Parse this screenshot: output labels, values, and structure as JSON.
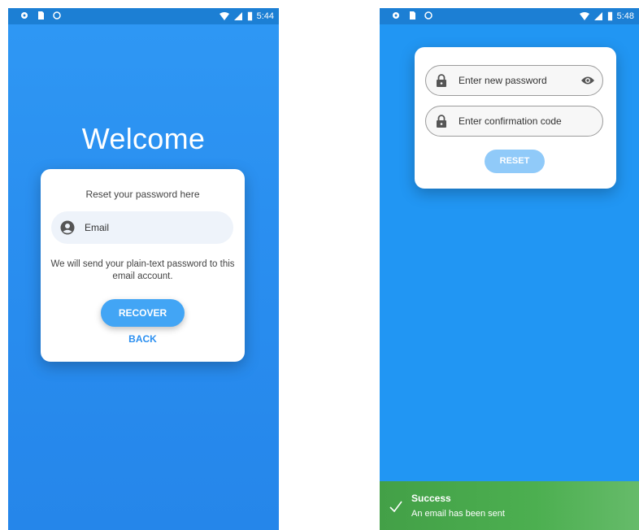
{
  "left_screen": {
    "status_time": "5:44",
    "welcome_title": "Welcome",
    "card": {
      "heading": "Reset your password here",
      "email_placeholder": "Email",
      "info_text": "We will send your plain-text password to this email account.",
      "recover_label": "RECOVER",
      "back_label": "BACK"
    }
  },
  "right_screen": {
    "status_time": "5:48",
    "card": {
      "new_password_placeholder": "Enter new password",
      "confirmation_code_placeholder": "Enter confirmation code",
      "reset_label": "RESET"
    },
    "snackbar": {
      "title": "Success",
      "message": "An email has been sent"
    }
  },
  "colors": {
    "primary_blue": "#2196f3",
    "button_blue": "#42a5f5",
    "success_green": "#4caf50"
  },
  "icons": [
    "settings-icon",
    "sd-card-icon",
    "record-icon",
    "wifi-icon",
    "signal-icon",
    "battery-icon",
    "account-circle-icon",
    "lock-icon",
    "eye-icon",
    "check-icon"
  ]
}
